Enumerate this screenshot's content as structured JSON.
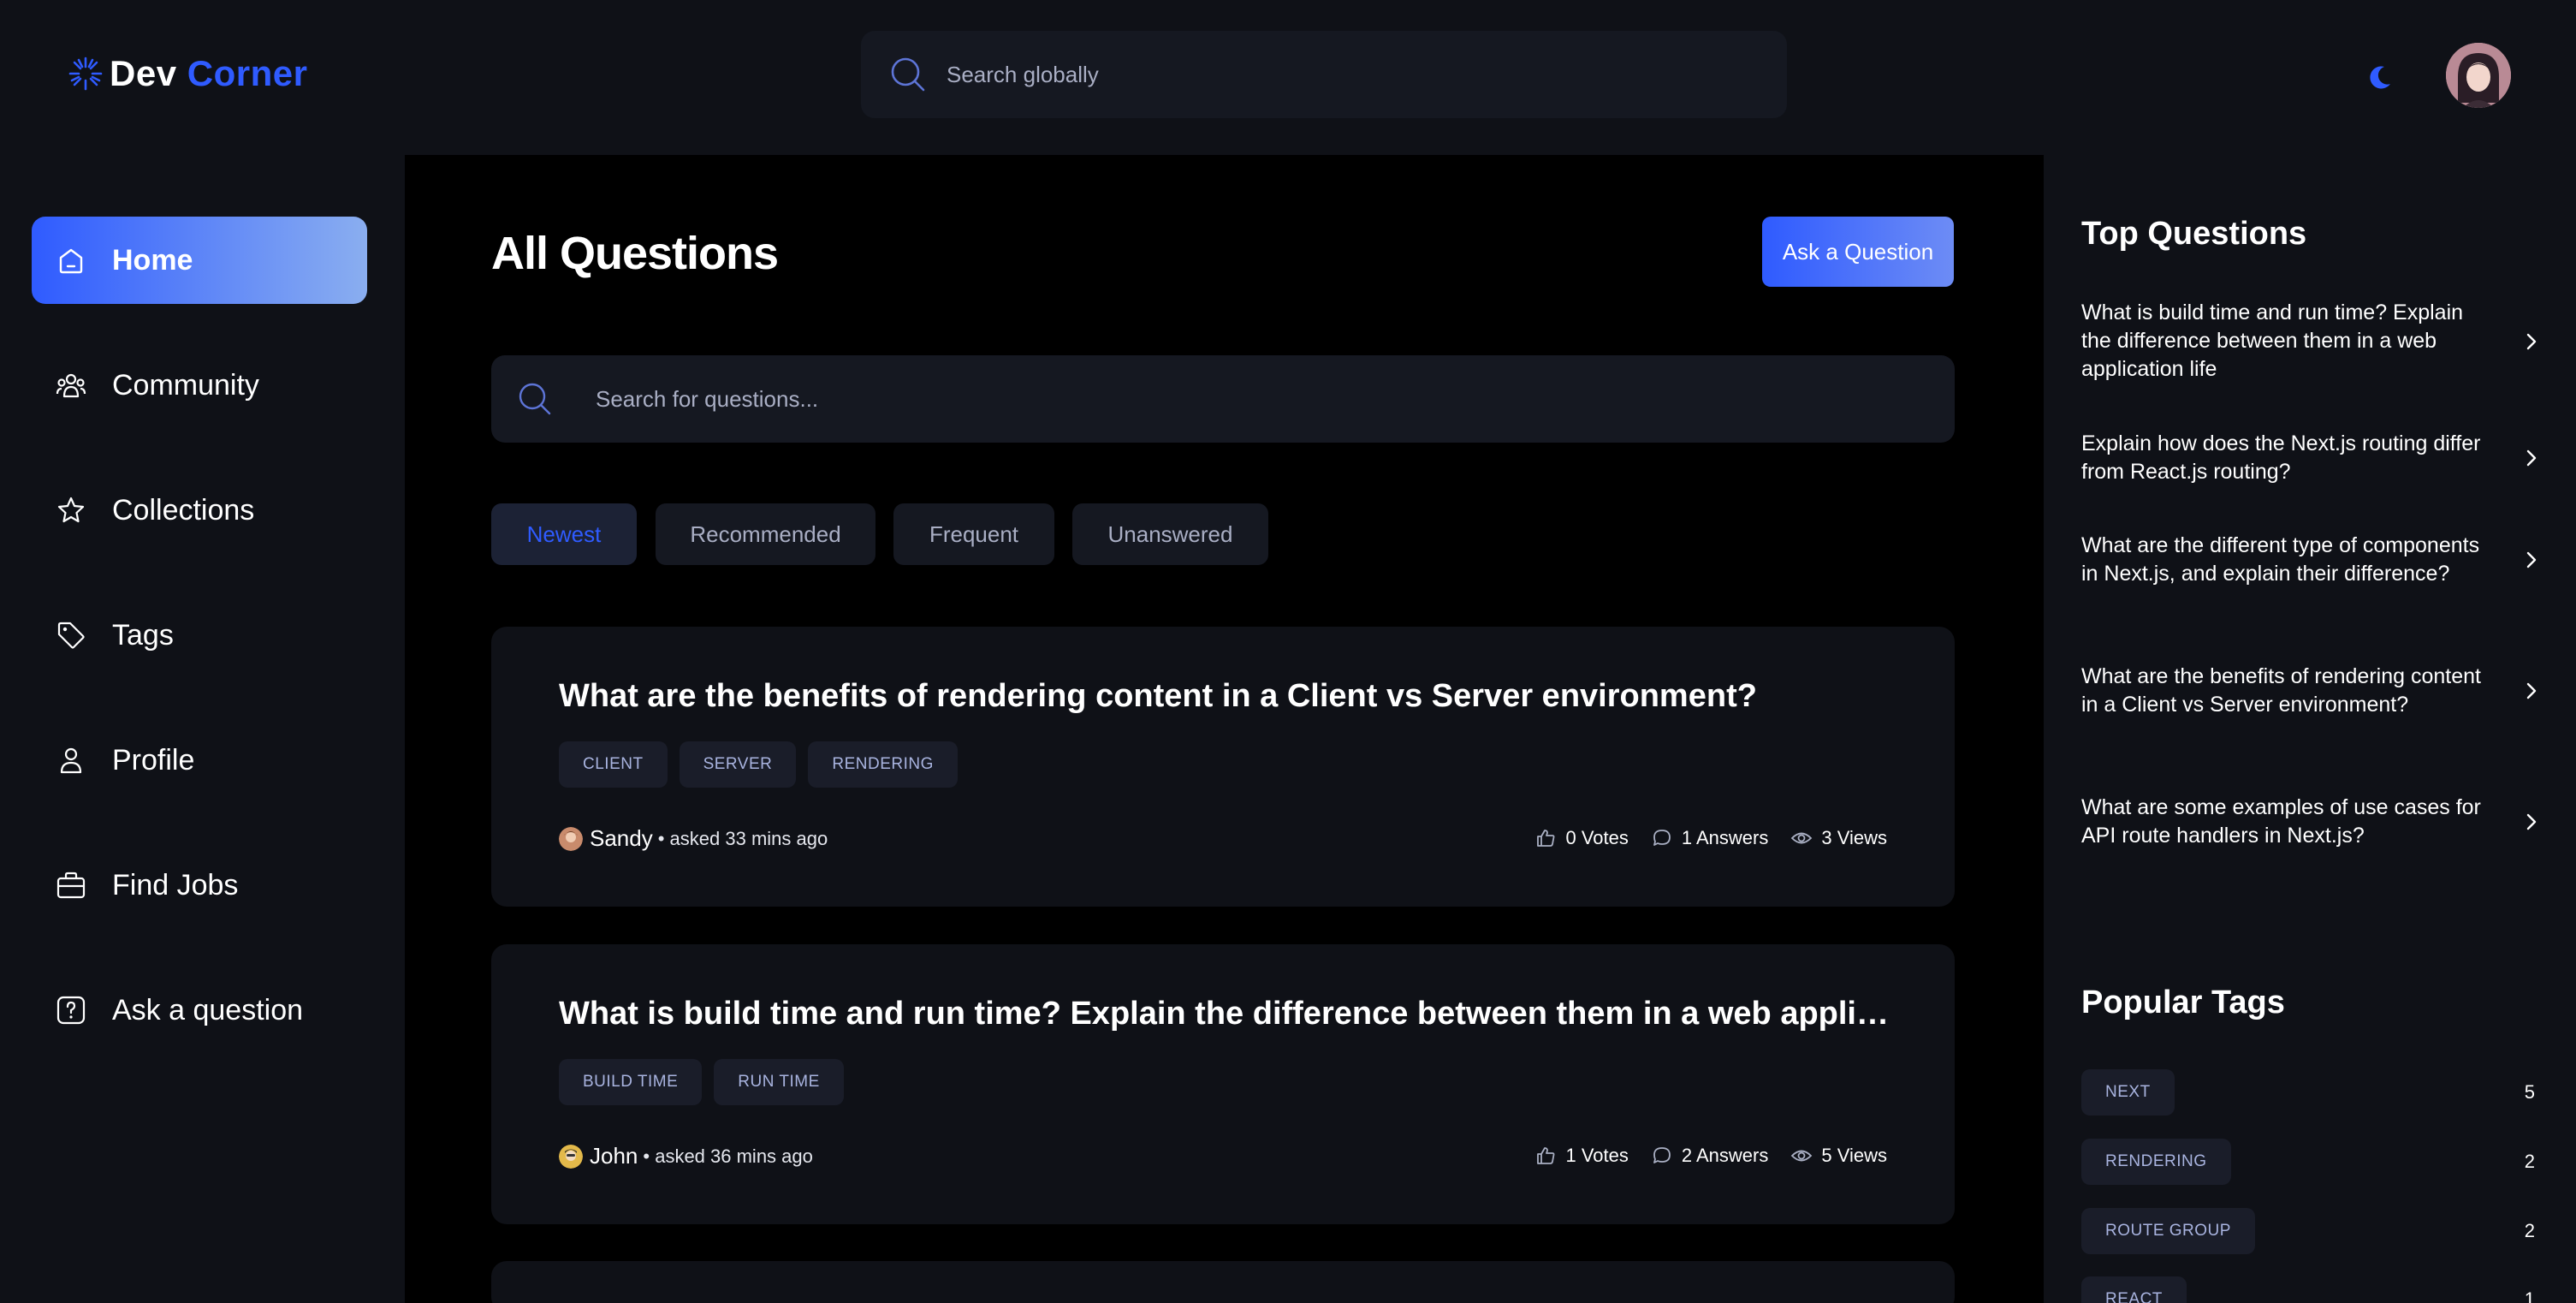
{
  "header": {
    "logo": {
      "word1": "Dev",
      "word2": "Corner",
      "icon": "sun-burst-icon"
    },
    "search_placeholder": "Search globally",
    "theme_icon": "moon-icon",
    "avatar": "user-avatar"
  },
  "sidebar": {
    "items": [
      {
        "label": "Home",
        "icon": "home-icon",
        "active": true
      },
      {
        "label": "Community",
        "icon": "users-icon"
      },
      {
        "label": "Collections",
        "icon": "star-icon"
      },
      {
        "label": "Tags",
        "icon": "tag-icon"
      },
      {
        "label": "Profile",
        "icon": "user-icon"
      },
      {
        "label": "Find Jobs",
        "icon": "briefcase-icon"
      },
      {
        "label": "Ask a question",
        "icon": "question-icon"
      }
    ]
  },
  "main": {
    "title": "All Questions",
    "ask_button": "Ask a Question",
    "search_placeholder": "Search for questions...",
    "filters": [
      {
        "label": "Newest",
        "active": true
      },
      {
        "label": "Recommended"
      },
      {
        "label": "Frequent"
      },
      {
        "label": "Unanswered"
      }
    ],
    "questions": [
      {
        "title": "What are the benefits of rendering content in a Client vs Server environment?",
        "tags": [
          "CLIENT",
          "SERVER",
          "RENDERING"
        ],
        "author": "Sandy",
        "meta": "• asked 33 mins ago",
        "votes": "0 Votes",
        "answers": "1 Answers",
        "views": "3 Views"
      },
      {
        "title": "What is build time and run time? Explain the difference between them in a web application life",
        "tags": [
          "BUILD TIME",
          "RUN TIME"
        ],
        "author": "John",
        "meta": "• asked 36 mins ago",
        "votes": "1 Votes",
        "answers": "2 Answers",
        "views": "5 Views"
      }
    ]
  },
  "rightbar": {
    "top_questions_heading": "Top Questions",
    "top_questions": [
      "What is build time and run time? Explain the difference between them in a web application life",
      "Explain how does the Next.js routing differ from React.js routing?",
      "What are the different type of components in Next.js, and explain their difference?",
      "What are the benefits of rendering content in a Client vs Server environment?",
      "What are some examples of use cases for API route handlers in Next.js?"
    ],
    "popular_tags_heading": "Popular Tags",
    "popular_tags": [
      {
        "name": "NEXT",
        "count": "5"
      },
      {
        "name": "RENDERING",
        "count": "2"
      },
      {
        "name": "ROUTE GROUP",
        "count": "2"
      },
      {
        "name": "REACT",
        "count": "1"
      }
    ]
  },
  "colors": {
    "accent": "#2f5bff",
    "background": "#000000",
    "panel": "#0f1117",
    "input": "#151821",
    "tag_bg": "#1a1d29",
    "tag_text": "#a9b4e0"
  }
}
